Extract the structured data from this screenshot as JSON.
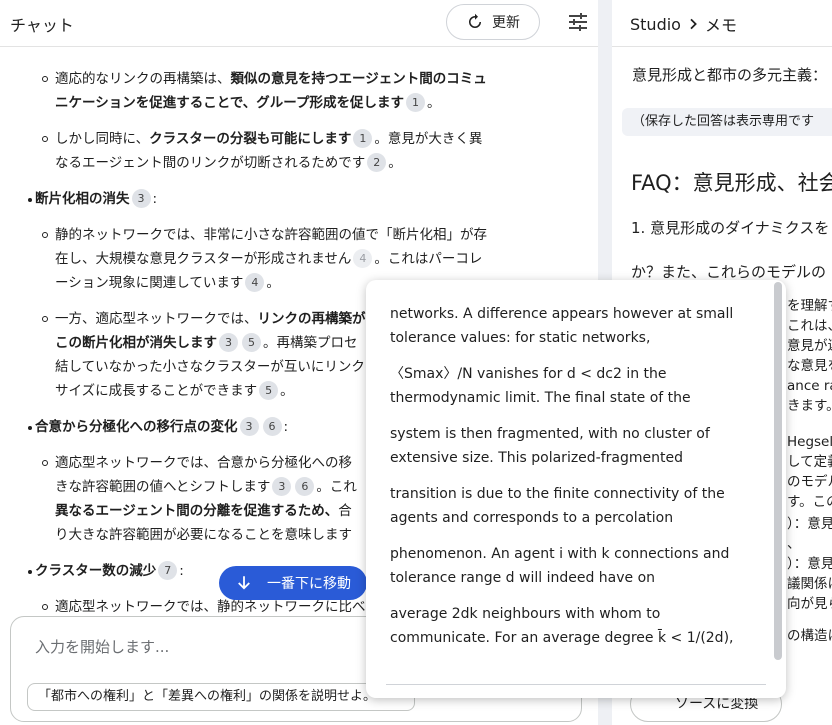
{
  "chat": {
    "title": "チャット",
    "refresh_label": "更新",
    "items": [
      {
        "segs": [
          {
            "t": "適応的なリンクの再構築は、"
          },
          {
            "t": "類似の意見を持つエージェント間のコミュ",
            "b": true
          }
        ]
      },
      {
        "segs": [
          {
            "t": "ニケーションを促進することで、グループ形成を促します",
            "b": true
          },
          {
            "c": "1"
          },
          {
            "t": "。"
          }
        ]
      },
      {
        "segs": [
          {
            "t": "しかし同時に、"
          },
          {
            "t": "クラスターの分裂も可能にします",
            "b": true
          },
          {
            "c": "1"
          },
          {
            "t": "。意見が大きく異"
          }
        ]
      },
      {
        "segs": [
          {
            "t": "なるエージェント間のリンクが切断されるためです"
          },
          {
            "c": "2"
          },
          {
            "t": "。"
          }
        ]
      },
      {
        "segs": [
          {
            "t": "断片化相の消失",
            "b": true
          },
          {
            "c": "3"
          },
          {
            "t": ":"
          }
        ]
      },
      {
        "segs": [
          {
            "t": "静的ネットワークでは、非常に小さな許容範囲の値で「断片化相」が存"
          }
        ]
      },
      {
        "segs": [
          {
            "t": "在し、大規模な意見クラスターが形成されません"
          },
          {
            "c": "4",
            "f": true
          },
          {
            "t": "。これはパーコレ"
          }
        ]
      },
      {
        "segs": [
          {
            "t": "ーション現象に関連しています"
          },
          {
            "c": "4"
          },
          {
            "t": "。"
          }
        ]
      },
      {
        "segs": [
          {
            "t": "一方、適応型ネットワークでは、"
          },
          {
            "t": "リンクの再構築が",
            "b": true
          }
        ]
      },
      {
        "segs": [
          {
            "t": "この断片化相が消失します",
            "b": true
          },
          {
            "c": "3"
          },
          {
            "c": "5"
          },
          {
            "t": "。再構築プロセ"
          }
        ]
      },
      {
        "segs": [
          {
            "t": "結していなかった小さなクラスターが互いにリンク"
          }
        ]
      },
      {
        "segs": [
          {
            "t": "サイズに成長することができます"
          },
          {
            "c": "5"
          },
          {
            "t": "。"
          }
        ]
      },
      {
        "segs": [
          {
            "t": "合意から分極化への移行点の変化",
            "b": true
          },
          {
            "c": "3"
          },
          {
            "c": "6"
          },
          {
            "t": ":"
          }
        ]
      },
      {
        "segs": [
          {
            "t": "適応型ネットワークでは、合意から分極化への移"
          }
        ]
      },
      {
        "segs": [
          {
            "t": "きな許容範囲の値へとシフトします"
          },
          {
            "c": "3"
          },
          {
            "c": "6"
          },
          {
            "t": "。これ"
          }
        ]
      },
      {
        "segs": [
          {
            "t": "異なるエージェント間の分離を促進するため、",
            "b": true
          },
          {
            "t": "合"
          }
        ]
      },
      {
        "segs": [
          {
            "t": "り大きな許容範囲が必要になることを意味します"
          }
        ]
      },
      {
        "segs": [
          {
            "t": "クラスター数の減少",
            "b": true
          },
          {
            "c": "7"
          },
          {
            "t": ":"
          }
        ]
      },
      {
        "segs": [
          {
            "t": "適応型ネットワークでは、静的ネットワークに比べ"
          }
        ]
      }
    ],
    "scroll_bottom_label": "一番下に移動",
    "input_placeholder": "入力を開始します...",
    "suggestion": "「都市への権利」と「差異への権利」の関係を説明せよ。"
  },
  "studio": {
    "crumb_root": "Studio",
    "crumb_leaf": "メモ",
    "note_title": "意見形成と都市の多元主義：",
    "readonly_note": "（保存した回答は表示専用です",
    "faq_heading": "FAQ：意見形成、社会",
    "lines": [
      "1. 意見形成のダイナミクスを",
      "か？また、これらのモデルの",
      "を理解す",
      "これは、",
      "意見が連",
      "な意見を",
      "ance ra",
      "きます。",
      "Hegseln",
      "して定義",
      "のモデル",
      "す。この",
      "）：意見",
      "、",
      "）：意見",
      "議関係に",
      "向が見ら",
      "の構造に"
    ],
    "convert_label": "ソースに変換"
  },
  "popup": {
    "paragraphs": [
      "networks. A difference appears however at small tolerance values: for static networks,",
      "〈Smax〉/N vanishes for d < dc2 in the thermodynamic limit. The final state of the",
      "system is then fragmented, with no cluster of extensive size. This polarized-fragmented",
      "transition is due to the finite connectivity of the agents and corresponds to a percolation",
      "phenomenon. An agent i with k connections and tolerance range d will indeed have on",
      "average 2dk neighbours with whom to communicate. For an average degree k̄ < 1/(2d),"
    ]
  }
}
